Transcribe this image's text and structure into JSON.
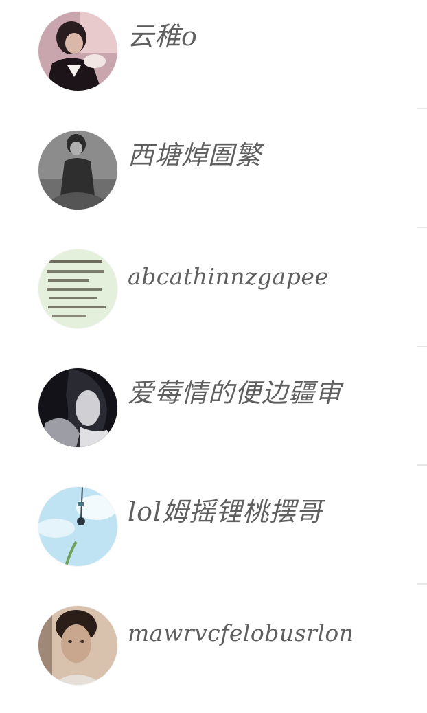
{
  "users": [
    {
      "name": "云稚o",
      "avatar_desc": "portrait-couple"
    },
    {
      "name": "西塘焯圄繁",
      "avatar_desc": "portrait-sitting-grayscale"
    },
    {
      "name": "abcathinnzgapee",
      "avatar_desc": "handwritten-note"
    },
    {
      "name": "爱莓情的便边疆审",
      "avatar_desc": "portrait-woman-dark"
    },
    {
      "name": "lol姆摇锂桃摆哥",
      "avatar_desc": "sky-blue-nature"
    },
    {
      "name": "mawrvcfelobusrlon",
      "avatar_desc": "portrait-man"
    }
  ],
  "colors": {
    "name_text": "#5f5f5f",
    "background": "#ffffff"
  }
}
